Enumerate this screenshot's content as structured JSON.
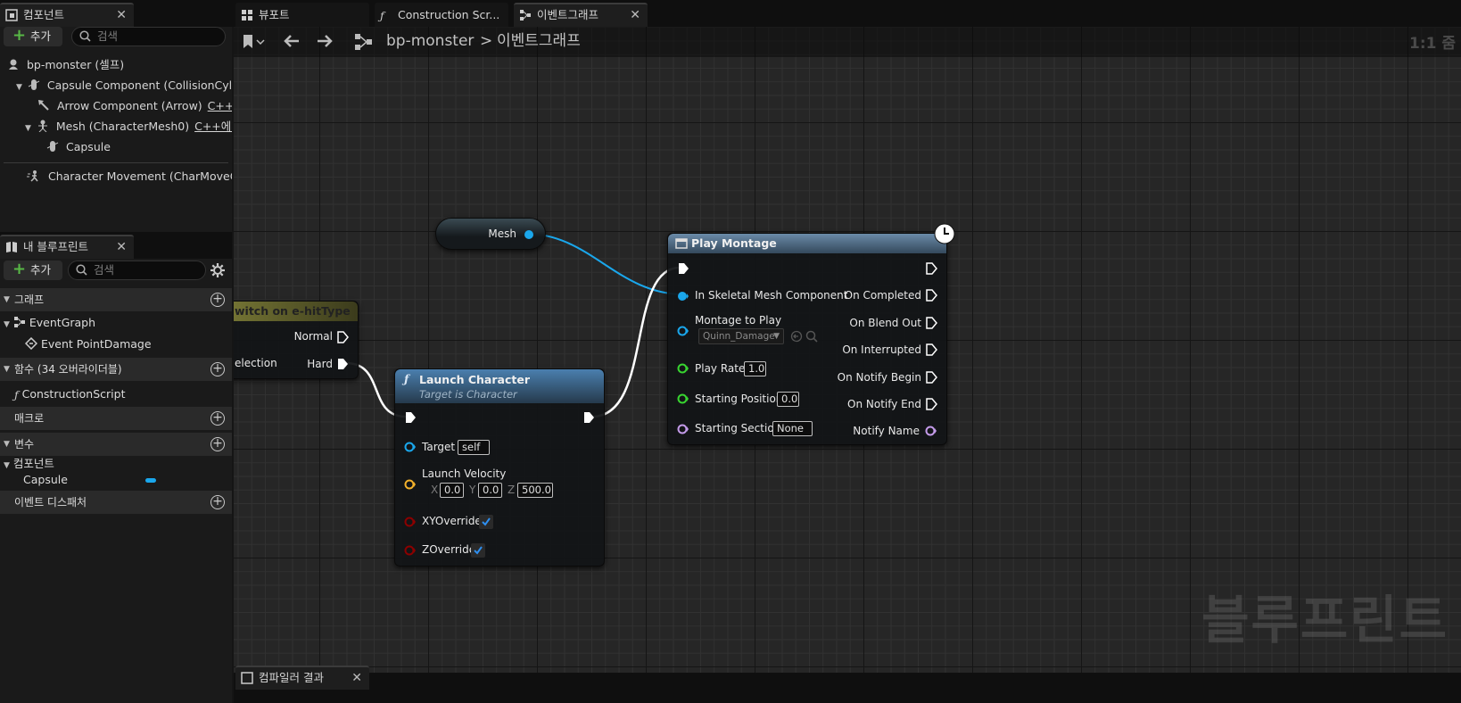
{
  "components_panel": {
    "tab_label": "컴포넌트",
    "add_label": "추가",
    "search_placeholder": "검색",
    "tree": [
      {
        "label": "bp-monster (셀프)"
      },
      {
        "label": "Capsule Component (CollisionCylinder"
      },
      {
        "label": "Arrow Component (Arrow)",
        "tag": "C++에서"
      },
      {
        "label": "Mesh (CharacterMesh0)",
        "tag": "C++에서 편"
      },
      {
        "label": "Capsule"
      },
      {
        "label": "Character Movement (CharMoveCom"
      }
    ]
  },
  "my_blueprint": {
    "tab_label": "내 블루프린트",
    "add_label": "추가",
    "search_placeholder": "검색",
    "sections": {
      "graphs": "그래프",
      "functions": "함수 (34 오버라이더블)",
      "macros": "매크로",
      "variables": "변수",
      "dispatchers": "이벤트 디스패처"
    },
    "event_graph": "EventGraph",
    "event_point_damage": "Event PointDamage",
    "construction_script": "ConstructionScript",
    "components_group": "컴포넌트",
    "capsule_var": "Capsule"
  },
  "editor_tabs": [
    {
      "label": "뷰포트"
    },
    {
      "label": "Construction Scr..."
    },
    {
      "label": "이벤트그래프"
    }
  ],
  "breadcrumb": {
    "root": "bp-monster",
    "sep": ">",
    "current": "이벤트그래프"
  },
  "zoom": "1:1 줌",
  "watermark": "블루프린트",
  "nodes": {
    "mesh_getter": {
      "label": "Mesh"
    },
    "switch": {
      "title": "witch on e-hitType",
      "pin_normal": "Normal",
      "pin_hard": "Hard",
      "pin_selection": "election"
    },
    "launch": {
      "title": "Launch Character",
      "subtitle": "Target is Character",
      "target_label": "Target",
      "target_value": "self",
      "velocity_label": "Launch Velocity",
      "x_label": "X",
      "x_value": "0.0",
      "y_label": "Y",
      "y_value": "0.0",
      "z_label": "Z",
      "z_value": "500.0",
      "xy_override": "XYOverride",
      "z_override": "ZOverride"
    },
    "play_montage": {
      "title": "Play Montage",
      "in_mesh": "In Skeletal Mesh Component",
      "montage": "Montage to Play",
      "montage_value": "Quinn_Damage",
      "play_rate": "Play Rate",
      "play_rate_value": "1.0",
      "start_pos": "Starting Position",
      "start_pos_value": "0.0",
      "start_section": "Starting Section",
      "start_section_value": "None",
      "on_completed": "On Completed",
      "on_blend_out": "On Blend Out",
      "on_interrupted": "On Interrupted",
      "on_notify_begin": "On Notify Begin",
      "on_notify_end": "On Notify End",
      "notify_name": "Notify Name"
    }
  },
  "bottom_tab": "컴파일러 결과",
  "colors": {
    "exec": "#ffffff",
    "object": "#1aa7ec",
    "struct": "#f3b12b",
    "bool": "#8c0000",
    "float": "#38d530",
    "name": "#c49bea",
    "play_montage_header": "#4a6f90",
    "launch_header": "#3e6a91",
    "switch_header": "#6b6b2a"
  }
}
